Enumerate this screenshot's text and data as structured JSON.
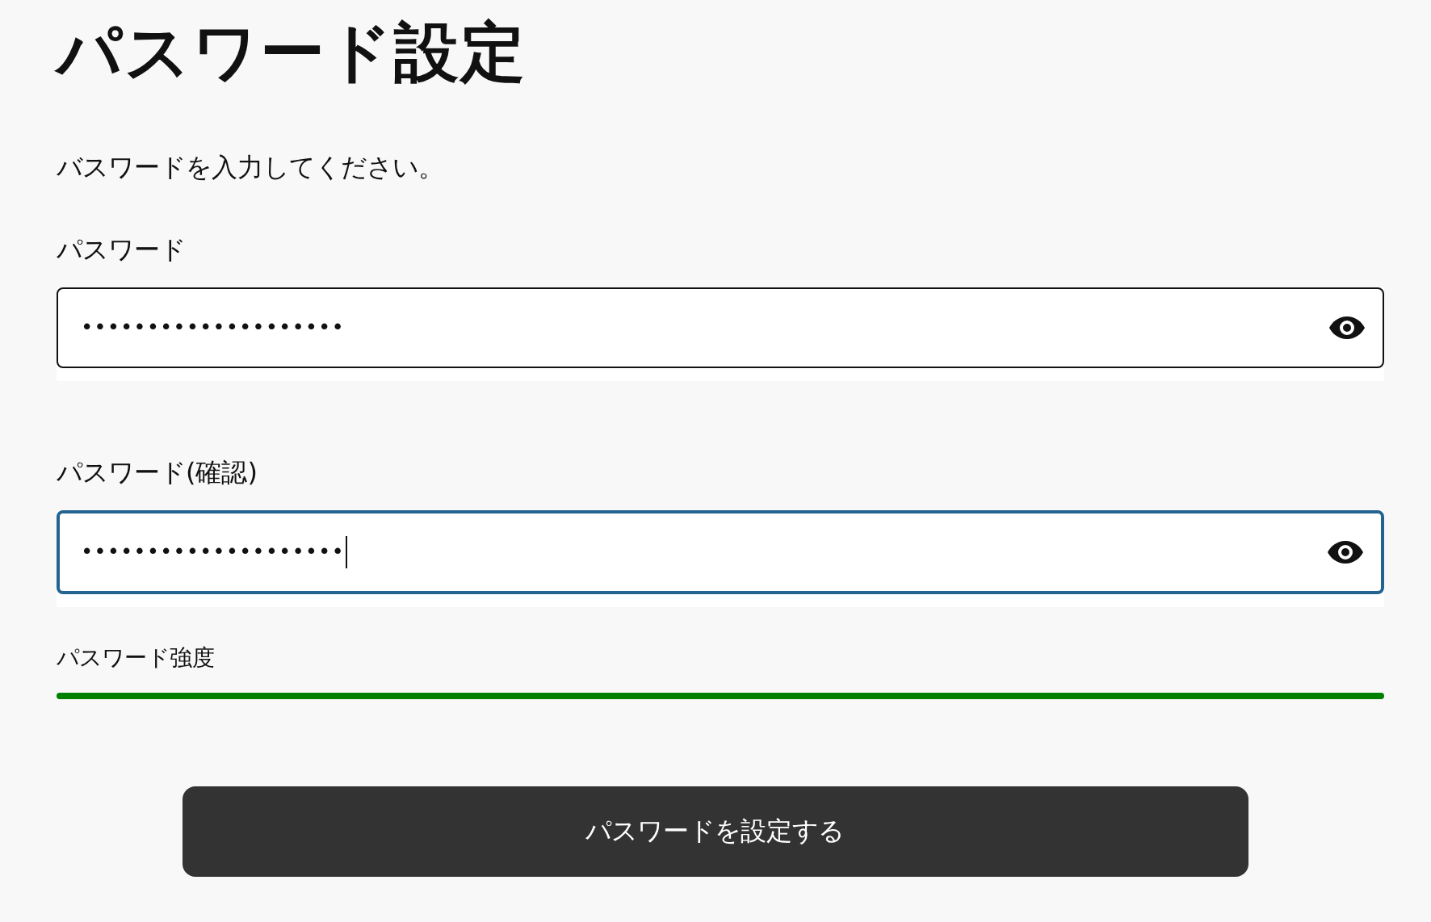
{
  "page": {
    "title": "パスワード設定",
    "instruction": "バスワードを入力してください。"
  },
  "fields": [
    {
      "label": "パスワード",
      "value": "••••••••••••••••••••",
      "focused": false
    },
    {
      "label": "パスワード(確認)",
      "value": "••••••••••••••••••••",
      "focused": true
    }
  ],
  "strength": {
    "label": "パスワード強度",
    "level": 1
  },
  "submit_button": {
    "label": "パスワードを設定する"
  }
}
